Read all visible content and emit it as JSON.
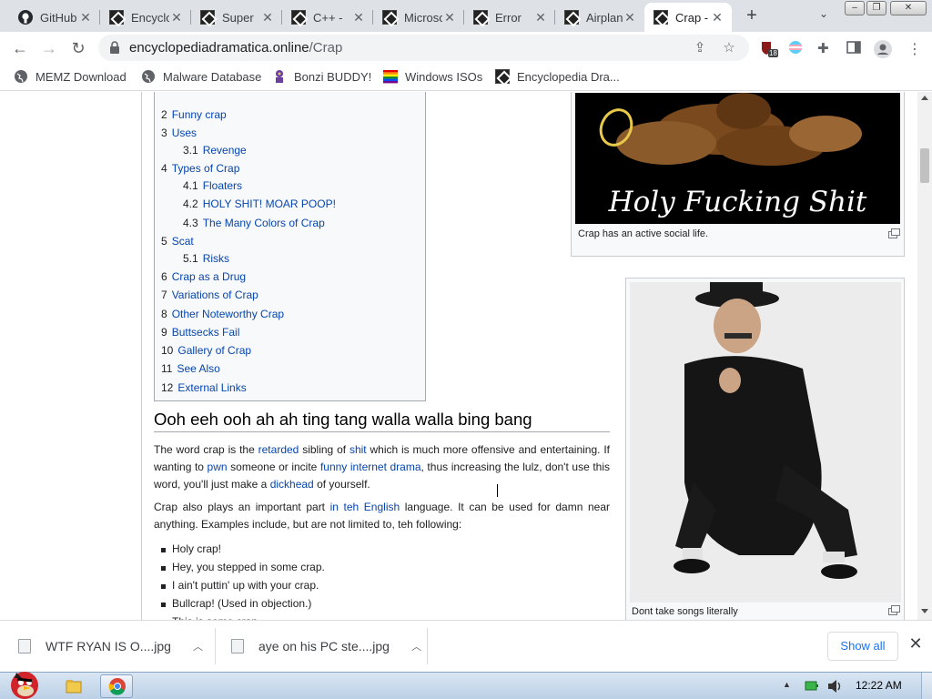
{
  "browser": {
    "tabs": [
      {
        "title": "GitHub",
        "icon": "github-icon",
        "active": false
      },
      {
        "title": "Encyclopedia Dramatica",
        "icon": "ed-icon",
        "active": false
      },
      {
        "title": "Super",
        "icon": "ed-icon",
        "active": false
      },
      {
        "title": "C++ -",
        "icon": "ed-icon",
        "active": false
      },
      {
        "title": "Microsoft",
        "icon": "ed-icon",
        "active": false
      },
      {
        "title": "Error",
        "icon": "ed-icon",
        "active": false
      },
      {
        "title": "Airplane",
        "icon": "ed-icon",
        "active": false
      },
      {
        "title": "Crap - Encyclopedia Dramatica",
        "icon": "ed-icon",
        "active": true
      }
    ],
    "url": {
      "domain": "encyclopediadramatica.online",
      "path": "/Crap"
    },
    "extension_badge": "18",
    "bookmarks": [
      {
        "label": "MEMZ Download",
        "icon": "globe-icon"
      },
      {
        "label": "Malware Database",
        "icon": "globe-icon"
      },
      {
        "label": "Bonzi BUDDY!",
        "icon": "bonzi-icon"
      },
      {
        "label": "Windows ISOs",
        "icon": "rainbow-flag-icon"
      },
      {
        "label": "Encyclopedia Dra...",
        "icon": "ed-icon"
      }
    ]
  },
  "article": {
    "toc": [
      {
        "num": "2",
        "label": "Funny crap",
        "level": 1
      },
      {
        "num": "3",
        "label": "Uses",
        "level": 1
      },
      {
        "num": "3.1",
        "label": "Revenge",
        "level": 2
      },
      {
        "num": "4",
        "label": "Types of Crap",
        "level": 1
      },
      {
        "num": "4.1",
        "label": "Floaters",
        "level": 2
      },
      {
        "num": "4.2",
        "label": "HOLY SHIT! MOAR POOP!",
        "level": 2
      },
      {
        "num": "4.3",
        "label": "The Many Colors of Crap",
        "level": 2
      },
      {
        "num": "5",
        "label": "Scat",
        "level": 1
      },
      {
        "num": "5.1",
        "label": "Risks",
        "level": 2
      },
      {
        "num": "6",
        "label": "Crap as a Drug",
        "level": 1
      },
      {
        "num": "7",
        "label": "Variations of Crap",
        "level": 1
      },
      {
        "num": "8",
        "label": "Other Noteworthy Crap",
        "level": 1
      },
      {
        "num": "9",
        "label": "Buttsecks Fail",
        "level": 1
      },
      {
        "num": "10",
        "label": "Gallery of Crap",
        "level": 1
      },
      {
        "num": "11",
        "label": "See Also",
        "level": 1
      },
      {
        "num": "12",
        "label": "External Links",
        "level": 1
      }
    ],
    "heading": "Ooh eeh ooh ah ah ting tang walla walla bing bang",
    "p1": {
      "t1": "The word crap is the ",
      "l1": "retarded",
      "t2": " sibling of ",
      "l2": "shit",
      "t3": " which is much more offensive and entertaining. If wanting to ",
      "l3": "pwn",
      "t4": " someone or incite ",
      "l4": "funny internet drama",
      "t5": ", thus increasing the lulz, don't use this word, you'll just make a ",
      "l5": "dickhead",
      "t6": " of yourself."
    },
    "p2": {
      "t1": "Crap also plays an important part ",
      "l1": "in teh English",
      "t2": " language. It can be used for damn near anything. Examples include, but are not limited to, teh following:"
    },
    "bullets": [
      "Holy crap!",
      "Hey, you stepped in some crap.",
      "I ain't puttin' up with your crap.",
      "Bullcrap! (Used in objection.)",
      "This is some crap."
    ],
    "image1": {
      "banner_text": "Holy Fucking Shit",
      "caption": "Crap has an active social life."
    },
    "image2": {
      "caption": "Dont take songs literally"
    }
  },
  "downloads": {
    "items": [
      {
        "name": "WTF RYAN IS O....jpg"
      },
      {
        "name": "aye on his PC ste....jpg"
      }
    ],
    "show_all": "Show all"
  },
  "taskbar": {
    "clock": "12:22 AM"
  },
  "colors": {
    "link": "#0645ad",
    "tabstrip": "#dee1e6",
    "accent_blue": "#1a73e8"
  }
}
